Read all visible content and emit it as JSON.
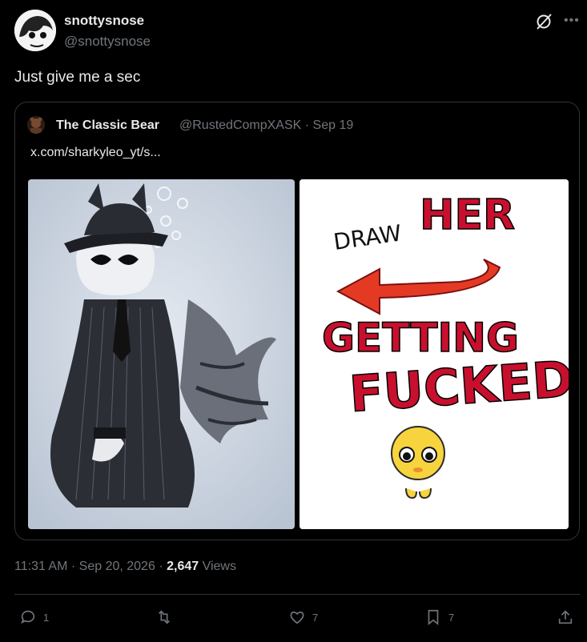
{
  "author": {
    "display_name": "snottysnose",
    "handle": "@snottysnose"
  },
  "post": {
    "text": "Just give me a sec"
  },
  "quote": {
    "display_name": "The Classic Bear",
    "handle": "@RustedCompXASK",
    "separator": "·",
    "date": "Sep 19",
    "link_text": "x.com/sharkyleo_yt/s..."
  },
  "meme": {
    "line1_small": "DRAW",
    "line1_big": "HER",
    "line2": "GETTING",
    "line3": "FUCKED"
  },
  "meta": {
    "time": "11:31 AM",
    "sep": "·",
    "date": "Sep 20, 2026",
    "views_count": "2,647",
    "views_label": "Views"
  },
  "actions": {
    "replies": "1",
    "reposts": "",
    "likes": "7",
    "bookmarks": "7"
  },
  "icons": [
    "grok-icon",
    "more-icon",
    "reply-icon",
    "repost-icon",
    "like-icon",
    "bookmark-icon",
    "share-icon"
  ]
}
